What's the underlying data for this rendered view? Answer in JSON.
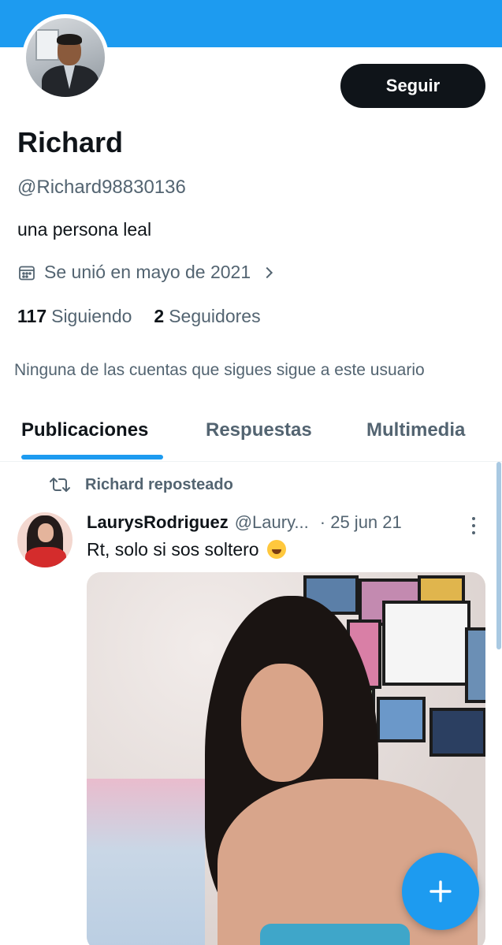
{
  "profile": {
    "follow_label": "Seguir",
    "name": "Richard",
    "handle": "@Richard98830136",
    "bio": "una persona leal",
    "joined": "Se unió en mayo de 2021",
    "following_count": "117",
    "following_label": "Siguiendo",
    "followers_count": "2",
    "followers_label": "Seguidores",
    "mutuals_note": "Ninguna de las cuentas que sigues sigue a este usuario"
  },
  "tabs": [
    {
      "label": "Publicaciones",
      "active": true
    },
    {
      "label": "Respuestas",
      "active": false
    },
    {
      "label": "Multimedia",
      "active": false
    }
  ],
  "post": {
    "repost_label": "Richard reposteado",
    "author_name": "LaurysRodriguez",
    "author_handle": "@Laury...",
    "date": "· 25 jun 21",
    "text": "Rt, solo si sos soltero",
    "emoji": "rolling-on-floor-laughing"
  },
  "colors": {
    "accent": "#1d9bf0",
    "text_primary": "#0f1419",
    "text_secondary": "#536471",
    "follow_button_bg": "#0f1419"
  },
  "icons": {
    "calendar": "calendar-icon",
    "chevron": "chevron-right-icon",
    "repost": "repost-icon",
    "more": "more-vertical-icon",
    "compose": "plus-icon"
  }
}
